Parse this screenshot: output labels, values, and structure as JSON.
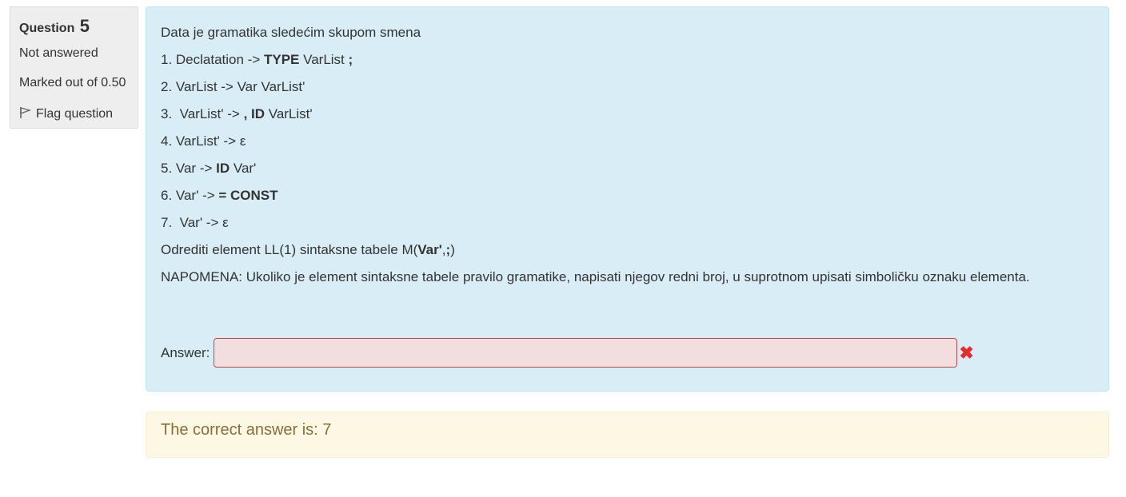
{
  "info": {
    "question_label": "Question",
    "question_number": "5",
    "state": "Not answered",
    "grade": "Marked out of 0.50",
    "flag_label": "Flag question"
  },
  "question": {
    "intro": "Data je gramatika sledećim skupom smena",
    "rules": [
      {
        "pre": "1. Declatation -> ",
        "b1": "TYPE",
        "mid": " VarList ",
        "b2": ";",
        "post": ""
      },
      {
        "pre": "2. VarList -> Var VarList'",
        "b1": "",
        "mid": "",
        "b2": "",
        "post": ""
      },
      {
        "pre": "3.  VarList' -> ",
        "b1": ", ID",
        "mid": " VarList'",
        "b2": "",
        "post": ""
      },
      {
        "pre": "4. VarList' -> ε",
        "b1": "",
        "mid": "",
        "b2": "",
        "post": ""
      },
      {
        "pre": "5. Var -> ",
        "b1": "ID",
        "mid": " Var'",
        "b2": "",
        "post": ""
      },
      {
        "pre": "6. Var' -> ",
        "b1": "= CONST",
        "mid": "",
        "b2": "",
        "post": ""
      },
      {
        "pre": "7.  Var' -> ε",
        "b1": "",
        "mid": "",
        "b2": "",
        "post": ""
      }
    ],
    "task": {
      "pre": "Odrediti element LL(1) sintaksne tabele M(",
      "b1": "Var'",
      "mid": ",",
      "b2": ";",
      "post": ")"
    },
    "note": "NAPOMENA: Ukoliko je element sintaksne tabele pravilo gramatike, napisati njegov redni broj, u suprotnom upisati simboličku oznaku elementa."
  },
  "answer": {
    "label": "Answer:",
    "value": "",
    "status_icon": "incorrect-x-icon",
    "status_color": "#e52d2d"
  },
  "outcome": {
    "right_answer": "The correct answer is: 7"
  },
  "colors": {
    "formulation_bg": "#d9edf7",
    "info_bg": "#eeeeee",
    "outcome_bg": "#fcf8e3",
    "answer_bg": "#f2dede"
  }
}
